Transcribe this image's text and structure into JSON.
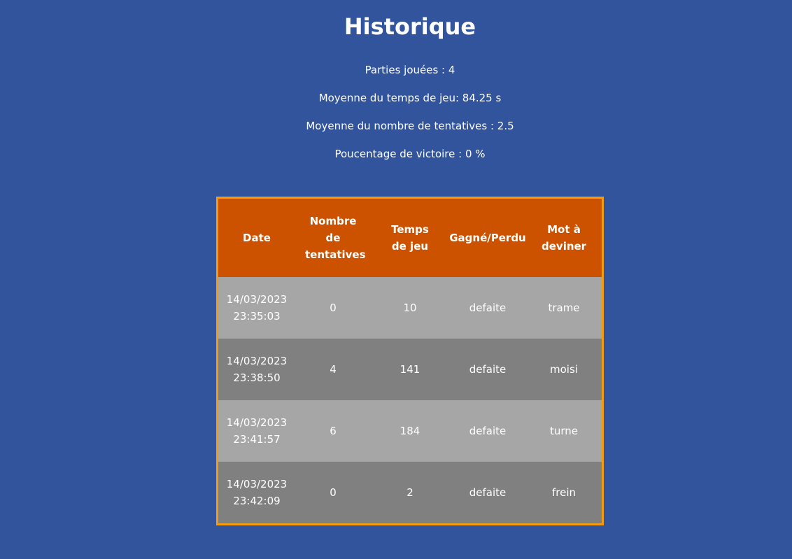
{
  "page": {
    "title": "Historique"
  },
  "stats": {
    "games_played": "Parties jouées : 4",
    "avg_time": "Moyenne du temps de jeu: 84.25 s",
    "avg_attempts": "Moyenne du nombre de tentatives : 2.5",
    "win_rate": "Poucentage de victoire : 0 %"
  },
  "table": {
    "headers": [
      "Date",
      "Nombre de tentatives",
      "Temps de jeu",
      "Gagné/Perdu",
      "Mot à deviner"
    ],
    "rows": [
      {
        "date": "14/03/2023 23:35:03",
        "tentatives": "0",
        "temps": "10",
        "resultat": "defaite",
        "mot": "trame"
      },
      {
        "date": "14/03/2023 23:38:50",
        "tentatives": "4",
        "temps": "141",
        "resultat": "defaite",
        "mot": "moisi"
      },
      {
        "date": "14/03/2023 23:41:57",
        "tentatives": "6",
        "temps": "184",
        "resultat": "defaite",
        "mot": "turne"
      },
      {
        "date": "14/03/2023 23:42:09",
        "tentatives": "0",
        "temps": "2",
        "resultat": "defaite",
        "mot": "frein"
      }
    ]
  },
  "colors": {
    "background": "#32549d",
    "header": "#cc5200",
    "border": "#f39c12",
    "row_light": "#a6a6a6",
    "row_dark": "#808080"
  }
}
